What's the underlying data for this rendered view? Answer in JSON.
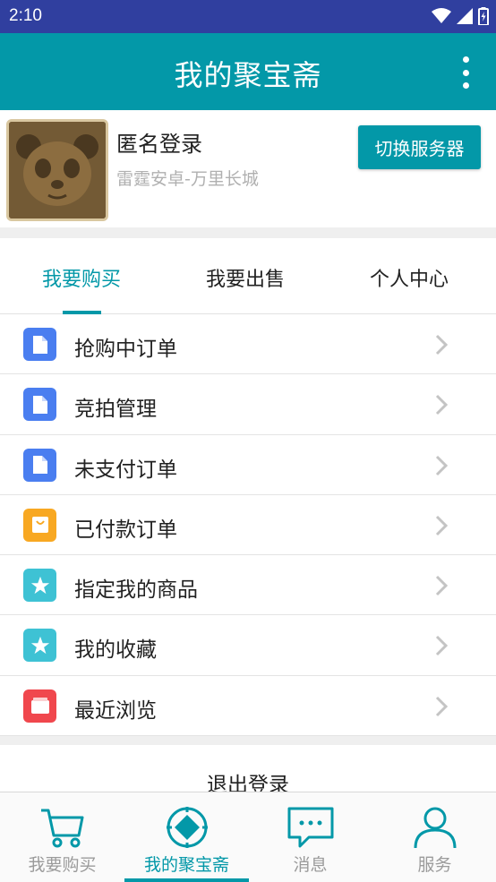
{
  "status_bar": {
    "time": "2:10"
  },
  "app_bar": {
    "title": "我的聚宝斋"
  },
  "profile": {
    "name": "匿名登录",
    "server": "雷霆安卓-万里长城",
    "switch_button": "切换服务器"
  },
  "tabs": [
    {
      "label": "我要购买",
      "active": true
    },
    {
      "label": "我要出售",
      "active": false
    },
    {
      "label": "个人中心",
      "active": false
    }
  ],
  "menu_items": [
    {
      "label": "抢购中订单",
      "icon": "document-icon",
      "color": "#4a7ef0"
    },
    {
      "label": "竞拍管理",
      "icon": "document-icon",
      "color": "#4a7ef0"
    },
    {
      "label": "未支付订单",
      "icon": "document-icon",
      "color": "#4a7ef0"
    },
    {
      "label": "已付款订单",
      "icon": "shopping-bag-icon",
      "color": "#f8a822"
    },
    {
      "label": "指定我的商品",
      "icon": "star-icon",
      "color": "#3ec2d4"
    },
    {
      "label": "我的收藏",
      "icon": "star-icon",
      "color": "#3ec2d4"
    },
    {
      "label": "最近浏览",
      "icon": "folder-icon",
      "color": "#f0474d"
    }
  ],
  "logout": {
    "label": "退出登录"
  },
  "bottom_nav": [
    {
      "label": "我要购买",
      "icon": "cart-icon",
      "active": false
    },
    {
      "label": "我的聚宝斋",
      "icon": "compass-icon",
      "active": true
    },
    {
      "label": "消息",
      "icon": "message-icon",
      "active": false
    },
    {
      "label": "服务",
      "icon": "person-icon",
      "active": false
    }
  ],
  "colors": {
    "primary": "#0398a8",
    "status_bar": "#303f9f"
  }
}
